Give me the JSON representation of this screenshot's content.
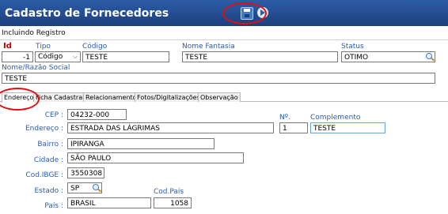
{
  "window": {
    "title": "Cadastro de Fornecedores"
  },
  "toolbar": {
    "icons": [
      "save-icon",
      "exit-icon"
    ]
  },
  "mode": {
    "label": "Incluindo Registro"
  },
  "header": {
    "id_label": "Id",
    "id_value": "-1",
    "tipo_label": "Tipo",
    "tipo_value": "Código",
    "codigo_label": "Código",
    "codigo_value": "TESTE",
    "fantasia_label": "Nome Fantasia",
    "fantasia_value": "TESTE",
    "status_label": "Status",
    "status_value": "OTIMO",
    "razao_label": "Nome/Razão Social",
    "razao_value": "TESTE"
  },
  "tabs": [
    {
      "label": "Endereço"
    },
    {
      "label": "Ficha Cadastral"
    },
    {
      "label": "Relacionamento"
    },
    {
      "label": "Fotos/Digitalizações"
    },
    {
      "label": "Observação"
    }
  ],
  "address": {
    "cep_label": "CEP :",
    "cep_value": "04232-000",
    "endereco_label": "Endereço :",
    "endereco_value": "ESTRADA DAS LÁGRIMAS",
    "numero_label": "Nº.",
    "numero_value": "1",
    "complemento_label": "Complemento",
    "complemento_value": "TESTE",
    "bairro_label": "Bairro :",
    "bairro_value": "IPIRANGA",
    "cidade_label": "Cidade :",
    "cidade_value": "SÃO PAULO",
    "ibge_label": "Cod.IBGE :",
    "ibge_value": "3550308",
    "estado_label": "Estado :",
    "estado_value": "SP",
    "pais_label": "País :",
    "pais_value": "BRASIL",
    "codpais_label": "Cod.País",
    "codpais_value": "1058"
  },
  "colors": {
    "titlebar": "#1d3f7e",
    "label_blue": "#2a5cb0",
    "required_red": "#c00000",
    "highlight_oval": "#dd1111"
  }
}
